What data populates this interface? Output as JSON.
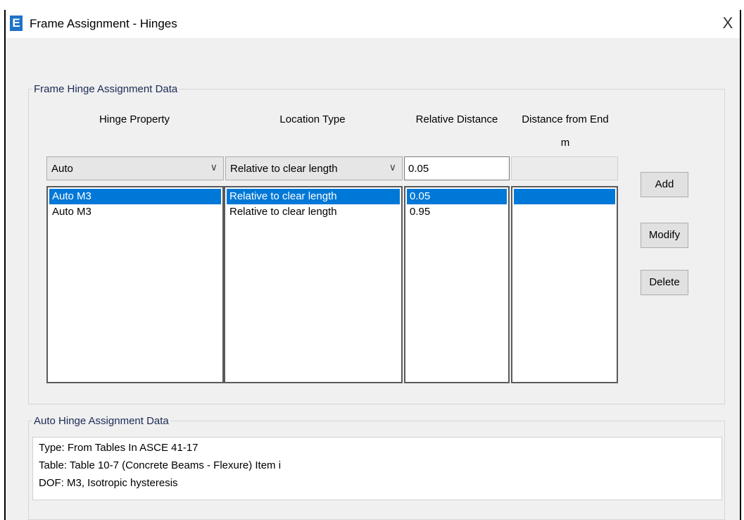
{
  "window": {
    "title": "Frame Assignment - Hinges",
    "icon_letter": "E",
    "close_glyph": "X"
  },
  "frame_group": {
    "label": "Frame Hinge Assignment Data",
    "headers": {
      "hinge_property": "Hinge Property",
      "location_type": "Location Type",
      "relative_distance": "Relative Distance",
      "distance_from_end": "Distance from End",
      "distance_unit": "m"
    },
    "inputs": {
      "hinge_property": "Auto",
      "location_type": "Relative to clear length",
      "relative_distance": "0.05",
      "distance_from_end": ""
    },
    "rows": [
      {
        "hinge": "Auto  M3",
        "location": "Relative to clear length",
        "relative": "0.05",
        "distance": "",
        "selected": true
      },
      {
        "hinge": "Auto  M3",
        "location": "Relative to clear length",
        "relative": "0.95",
        "distance": "",
        "selected": false
      }
    ]
  },
  "buttons": {
    "add": "Add",
    "modify": "Modify",
    "delete": "Delete"
  },
  "auto_group": {
    "label": "Auto Hinge Assignment Data",
    "lines": [
      "Type:  From Tables In ASCE 41-17",
      "Table:  Table 10-7 (Concrete Beams - Flexure) Item i",
      "DOF:  M3, Isotropic hysteresis"
    ]
  },
  "icons": {
    "dropdown": "chevron-down-icon",
    "close": "close-icon",
    "app": "etabs-app-icon"
  },
  "colors": {
    "selection": "#0078d7",
    "window_bg": "#f0f0f0",
    "app_icon": "#1e73c8"
  }
}
